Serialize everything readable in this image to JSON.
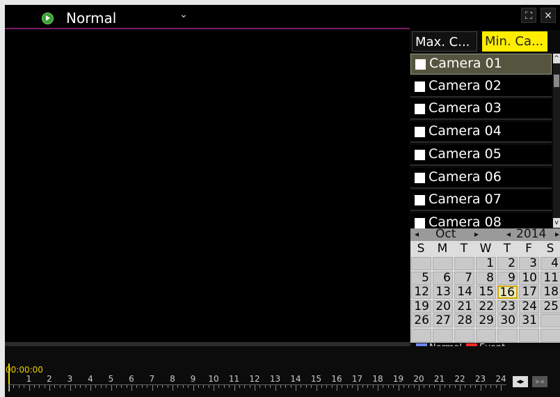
{
  "title_bar": {
    "mode": "Normal",
    "icons": [
      "play-icon",
      "chevron-down-icon",
      "fullscreen-icon",
      "close-icon"
    ],
    "close_glyph": "✕",
    "fullscreen_glyph": "⛶"
  },
  "tabs": {
    "max": "Max. C...",
    "min": "Min. Ca..."
  },
  "cameras": [
    {
      "label": "Camera 01",
      "selected": true
    },
    {
      "label": "Camera 02",
      "selected": false
    },
    {
      "label": "Camera 03",
      "selected": false
    },
    {
      "label": "Camera 04",
      "selected": false
    },
    {
      "label": "Camera 05",
      "selected": false
    },
    {
      "label": "Camera 06",
      "selected": false
    },
    {
      "label": "Camera 07",
      "selected": false
    },
    {
      "label": "Camera 08",
      "selected": false
    }
  ],
  "calendar": {
    "month": "Oct",
    "year": "2014",
    "weekdays": [
      "S",
      "M",
      "T",
      "W",
      "T",
      "F",
      "S"
    ],
    "today": "16",
    "rows": [
      [
        "",
        "",
        "",
        "1",
        "2",
        "3",
        "4"
      ],
      [
        "5",
        "6",
        "7",
        "8",
        "9",
        "10",
        "11"
      ],
      [
        "12",
        "13",
        "14",
        "15",
        "16",
        "17",
        "18"
      ],
      [
        "19",
        "20",
        "21",
        "22",
        "23",
        "24",
        "25"
      ],
      [
        "26",
        "27",
        "28",
        "29",
        "30",
        "31",
        ""
      ],
      [
        "",
        "",
        "",
        "",
        "",
        "",
        ""
      ]
    ]
  },
  "legend": [
    {
      "label": "Normal",
      "color": "#6f86ff"
    },
    {
      "label": "Event",
      "color": "#ff2a2a"
    }
  ],
  "timeline": {
    "time": "00:00:00",
    "hours": [
      "1",
      "2",
      "3",
      "4",
      "5",
      "6",
      "7",
      "8",
      "9",
      "10",
      "11",
      "12",
      "13",
      "14",
      "15",
      "16",
      "17",
      "18",
      "19",
      "20",
      "21",
      "22",
      "23",
      "24"
    ],
    "zoom_in": "◂▸",
    "zoom_out": "▸◂"
  }
}
